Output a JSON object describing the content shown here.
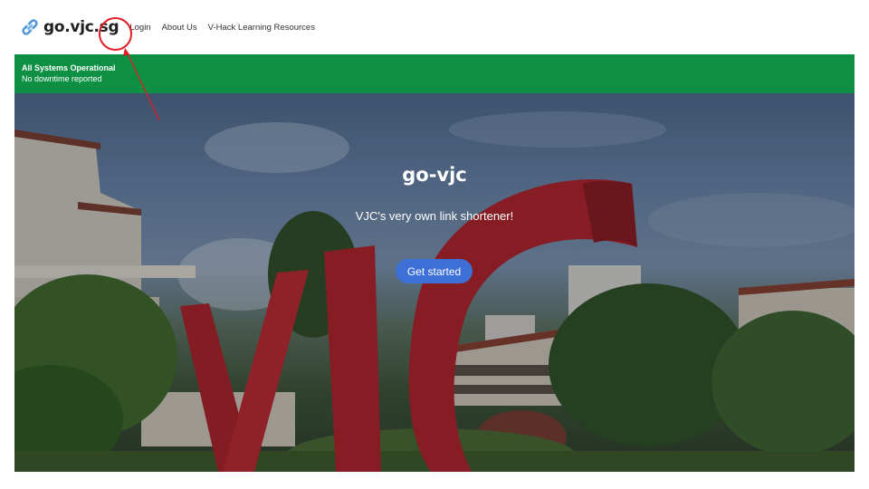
{
  "nav": {
    "brand": "go.vjc.sg",
    "brand_icon": "link-icon",
    "links": [
      "Login",
      "About Us",
      "V-Hack Learning Resources"
    ]
  },
  "status": {
    "title": "All Systems Operational",
    "subtitle": "No downtime reported",
    "color": "#0d9044"
  },
  "hero": {
    "title": "go-vjc",
    "subtitle": "VJC's very own link shortener!",
    "button": "Get started",
    "button_color": "#3d6fd6"
  },
  "annotation": {
    "color": "#e31b23"
  }
}
